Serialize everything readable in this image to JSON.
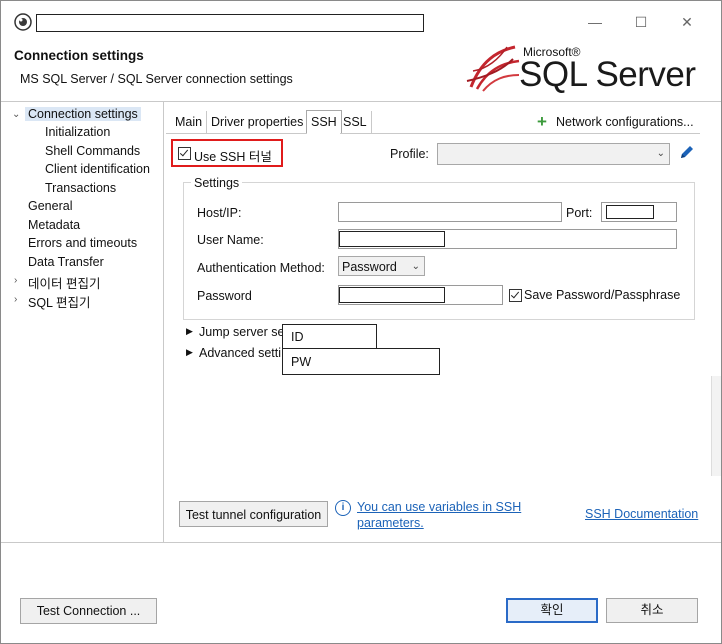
{
  "window": {
    "close_glyph": "✕",
    "maximize_glyph": "☐",
    "minimize_glyph": "—"
  },
  "header": {
    "title": "Connection settings",
    "subtitle": "MS SQL Server / SQL Server connection settings",
    "logo_microsoft": "Microsoft®",
    "logo_product": "SQL Server",
    "logo_reg": "®"
  },
  "sidebar": {
    "items": [
      {
        "label": "Connection settings",
        "expanded": true,
        "selected": true
      },
      {
        "label": "Initialization"
      },
      {
        "label": "Shell Commands"
      },
      {
        "label": "Client identification"
      },
      {
        "label": "Transactions"
      },
      {
        "label": "General"
      },
      {
        "label": "Metadata"
      },
      {
        "label": "Errors and timeouts"
      },
      {
        "label": "Data Transfer"
      },
      {
        "label": "데이터 편집기"
      },
      {
        "label": "SQL 편집기"
      }
    ]
  },
  "tabs": {
    "items": [
      "Main",
      "Driver properties",
      "SSH",
      "SSL"
    ],
    "active": "SSH",
    "network_config": "Network configurations..."
  },
  "ssh": {
    "use_ssh_label": "Use SSH 터널",
    "use_ssh_checked": true,
    "profile_label": "Profile:",
    "profile_value": "",
    "settings_group": "Settings",
    "host_label": "Host/IP:",
    "port_label": "Port:",
    "user_label": "User Name:",
    "auth_label": "Authentication Method:",
    "auth_value": "Password",
    "password_label": "Password",
    "save_password_label": "Save Password/Passphrase",
    "save_password_checked": true,
    "jump_server": "Jump server se",
    "advanced_settings": "Advanced setti",
    "popup_id": "ID",
    "popup_pw": "PW",
    "test_tunnel": "Test tunnel configuration",
    "info_text_line1": "You can use variables in SSH",
    "info_text_line2": "parameters.",
    "ssh_docs": "SSH Documentation"
  },
  "footer": {
    "test_connection": "Test Connection ...",
    "ok": "확인",
    "cancel": "취소"
  },
  "colors": {
    "accent": "#1c63b8",
    "highlight_box": "#e01b1b",
    "plus_green": "#3c9a3c"
  }
}
